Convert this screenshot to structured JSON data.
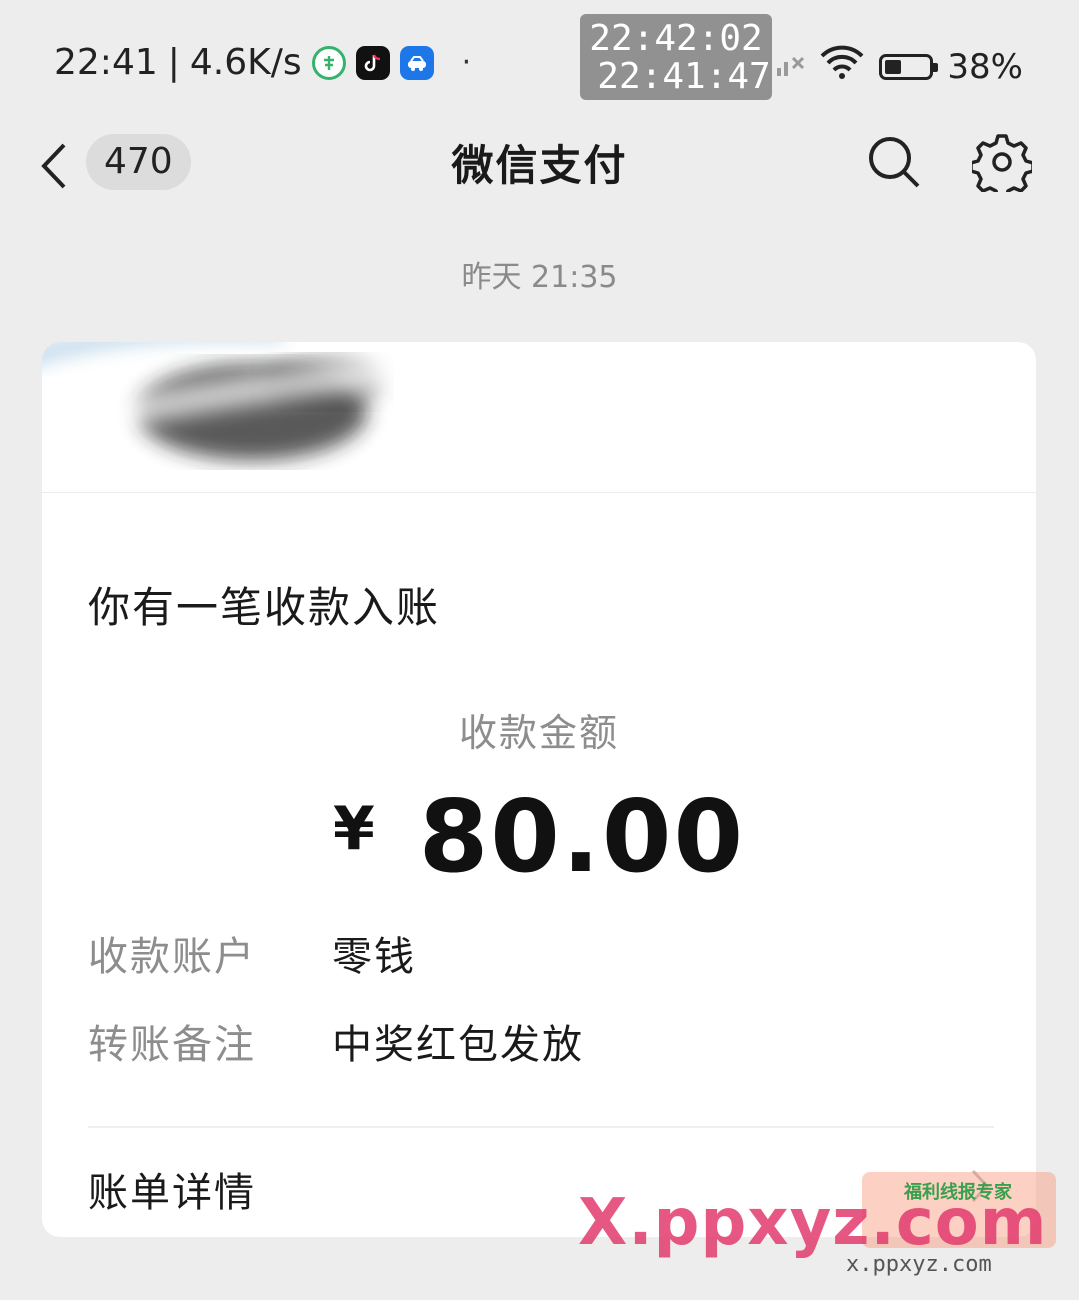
{
  "status_bar": {
    "time": "22:41",
    "separator": "|",
    "net_speed": "4.6K/s",
    "apps": [
      {
        "icon": "nongye-bank-icon",
        "label": ""
      },
      {
        "icon": "tiktok-icon",
        "label": ""
      },
      {
        "icon": "car-home-icon",
        "label": ""
      }
    ],
    "dot": "·",
    "overlay_time_top": "22:42:02",
    "overlay_time_bottom": "22:41:47",
    "battery_percent": "38%",
    "battery_level": 0.38
  },
  "nav": {
    "unread_count": "470",
    "title": "微信支付"
  },
  "message": {
    "timestamp": "昨天 21:35",
    "heading": "你有一笔收款入账",
    "amount_label": "收款金额",
    "currency": "¥",
    "amount": "80.00",
    "rows": [
      {
        "key": "收款账户",
        "value": "零钱"
      },
      {
        "key": "转账备注",
        "value": "中奖红包发放"
      }
    ],
    "bill_details": "账单详情"
  },
  "watermark": {
    "main": "X.ppxyz.com",
    "sub": "x.ppxyz.com",
    "badge": "福利线报专家"
  },
  "colors": {
    "background": "#ededed",
    "card": "#ffffff",
    "muted_text": "#8d8d8d"
  }
}
